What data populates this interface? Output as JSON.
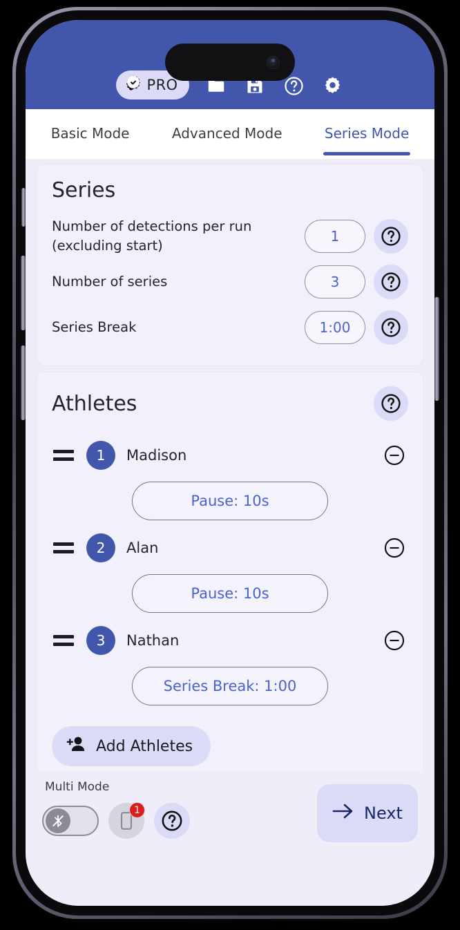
{
  "header": {
    "pro_label": "PRO",
    "icons": [
      {
        "name": "folder-icon"
      },
      {
        "name": "save-icon"
      },
      {
        "name": "help-icon"
      },
      {
        "name": "settings-gear-icon"
      }
    ],
    "bg_color": "#4256AC"
  },
  "tabs": [
    {
      "label": "Basic Mode",
      "active": false
    },
    {
      "label": "Advanced Mode",
      "active": false
    },
    {
      "label": "Series Mode",
      "active": true
    }
  ],
  "series_card": {
    "title": "Series",
    "rows": [
      {
        "label": "Number of detections per run (excluding start)",
        "value": "1"
      },
      {
        "label": "Number of series",
        "value": "3"
      },
      {
        "label": "Series Break",
        "value": "1:00"
      }
    ]
  },
  "athletes_card": {
    "title": "Athletes",
    "athletes": [
      {
        "number": "1",
        "name": "Madison",
        "action": "Pause: 10s"
      },
      {
        "number": "2",
        "name": "Alan",
        "action": "Pause: 10s"
      },
      {
        "number": "3",
        "name": "Nathan",
        "action": "Series Break: 1:00"
      }
    ],
    "add_button_label": "Add Athletes"
  },
  "bottom_bar": {
    "multi_mode_label": "Multi Mode",
    "bluetooth_toggle_state": "off",
    "device_badge_count": "1",
    "next_label": "Next"
  },
  "colors": {
    "accent": "#4256AC",
    "accent_light": "#DCDBF7",
    "link": "#4A61D0",
    "screen_bg": "#EEEDF8",
    "card_bg": "#F2F1FB",
    "badge_red": "#E01B1B"
  }
}
